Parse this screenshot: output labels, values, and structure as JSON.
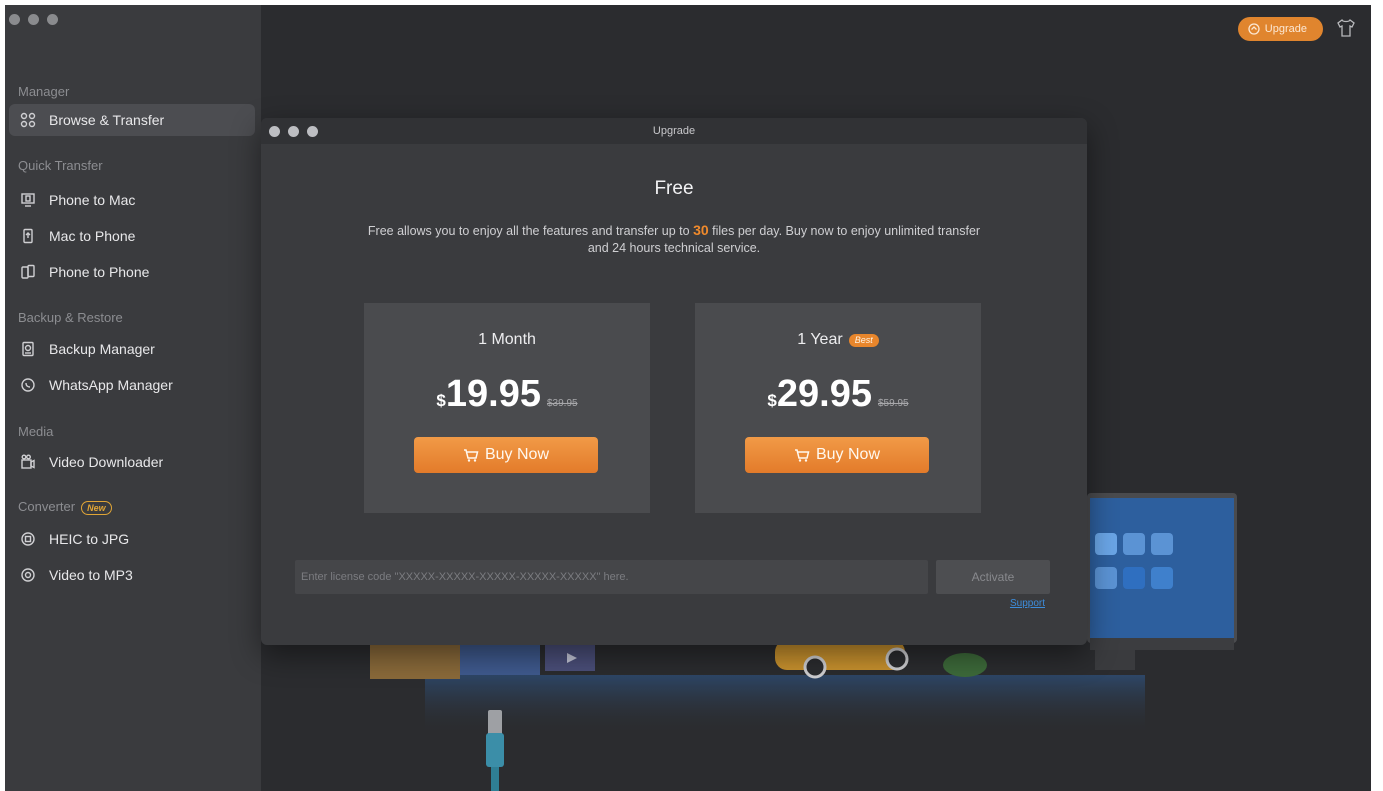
{
  "sidebar": {
    "sections": [
      {
        "label": "Manager"
      },
      {
        "label": "Quick Transfer"
      },
      {
        "label": "Backup & Restore"
      },
      {
        "label": "Media"
      },
      {
        "label": "Converter",
        "badge": "New"
      }
    ],
    "items": [
      {
        "label": "Browse & Transfer",
        "icon": "grid-icon",
        "active": true
      },
      {
        "label": "Phone to Mac",
        "icon": "phone-to-mac-icon"
      },
      {
        "label": "Mac to Phone",
        "icon": "mac-to-phone-icon"
      },
      {
        "label": "Phone to Phone",
        "icon": "phone-to-phone-icon"
      },
      {
        "label": "Backup Manager",
        "icon": "backup-icon"
      },
      {
        "label": "WhatsApp Manager",
        "icon": "whatsapp-icon"
      },
      {
        "label": "Video Downloader",
        "icon": "video-download-icon"
      },
      {
        "label": "HEIC to JPG",
        "icon": "heic-convert-icon"
      },
      {
        "label": "Video to MP3",
        "icon": "mp3-convert-icon"
      }
    ]
  },
  "topbar": {
    "upgrade_label": "Upgrade",
    "upgrade_icon": "upgrade-arrow-icon",
    "skin_icon": "shirt-icon"
  },
  "modal": {
    "title": "Upgrade",
    "plan_name": "Free",
    "desc_before": "Free allows you to enjoy all the features and transfer up to ",
    "desc_highlight": "30",
    "desc_after": " files per day. Buy now to enjoy unlimited transfer and 24 hours technical service.",
    "plans": [
      {
        "title": "1 Month",
        "currency": "$",
        "price": "19.95",
        "old_price": "$39.95",
        "button": "Buy Now"
      },
      {
        "title": "1 Year",
        "badge": "Best",
        "currency": "$",
        "price": "29.95",
        "old_price": "$59.95",
        "button": "Buy Now"
      }
    ],
    "license_placeholder": "Enter license code \"XXXXX-XXXXX-XXXXX-XXXXX-XXXXX\" here.",
    "activate_label": "Activate",
    "support_label": "Support"
  },
  "colors": {
    "accent": "#e8862c",
    "link": "#3d8ddb",
    "sidebar_bg": "#3a3b3e",
    "app_bg": "#2b2c2f"
  }
}
